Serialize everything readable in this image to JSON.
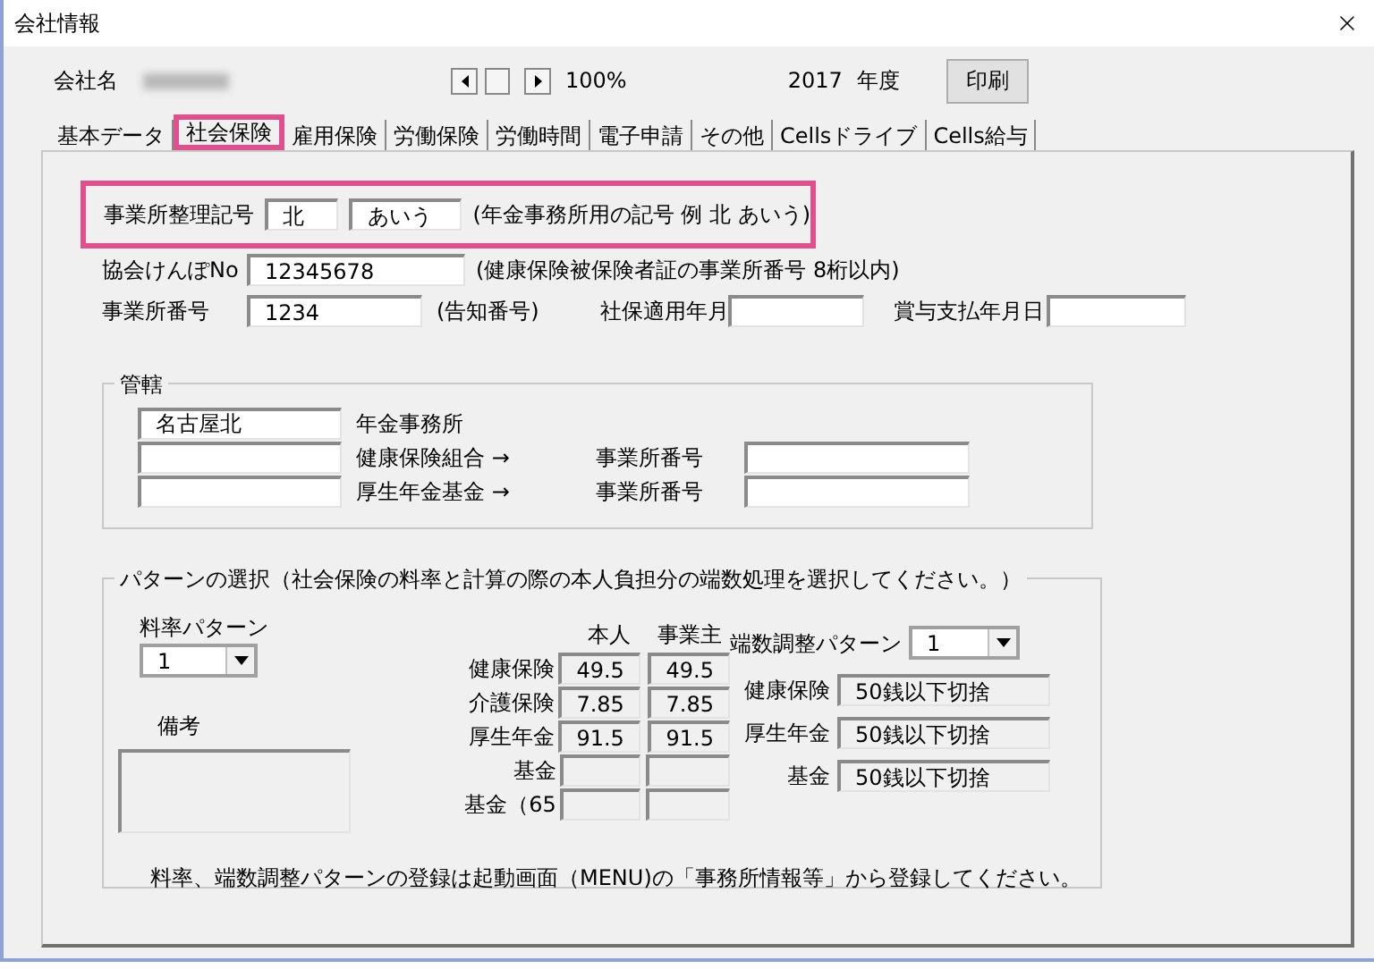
{
  "window": {
    "title": "会社情報"
  },
  "header": {
    "company_label": "会社名",
    "zoom": "100%",
    "year": "2017",
    "year_label": "年度",
    "print_button": "印刷"
  },
  "tabs": [
    {
      "label": "基本データ",
      "selected": false,
      "highlighted": false
    },
    {
      "label": "社会保険",
      "selected": true,
      "highlighted": true
    },
    {
      "label": "雇用保険",
      "selected": false,
      "highlighted": false
    },
    {
      "label": "労働保険",
      "selected": false,
      "highlighted": false
    },
    {
      "label": "労働時間",
      "selected": false,
      "highlighted": false
    },
    {
      "label": "電子申請",
      "selected": false,
      "highlighted": false
    },
    {
      "label": "その他",
      "selected": false,
      "highlighted": false
    },
    {
      "label": "Cellsドライブ",
      "selected": false,
      "highlighted": false
    },
    {
      "label": "Cells給与",
      "selected": false,
      "highlighted": false
    }
  ],
  "office_code": {
    "highlighted": true,
    "label": "事業所整理記号",
    "value_1": "北",
    "value_2": "あいう",
    "note": "(年金事務所用の記号  例  北  あいう)"
  },
  "kyokai": {
    "label": "協会けんぽNo",
    "value": "12345678",
    "note": "(健康保険被保険者証の事業所番号  8桁以内)"
  },
  "office_number": {
    "label": "事業所番号",
    "value": "1234",
    "note": "(告知番号)",
    "apply_label": "社保適用年月",
    "bonus_label": "賞与支払年月日"
  },
  "jurisdiction": {
    "title": "管轄",
    "rows": [
      {
        "value": "名古屋北",
        "label": "年金事務所"
      },
      {
        "label": "健康保険組合  →",
        "number_label": "事業所番号"
      },
      {
        "label": "厚生年金基金  →",
        "number_label": "事業所番号"
      }
    ]
  },
  "pattern": {
    "title": "パターンの選択（社会保険の料率と計算の際の本人負担分の端数処理を選択してください。）",
    "rate_pattern": {
      "label": "料率パターン",
      "value": "1"
    },
    "remarks_label": "備考",
    "columns": [
      "本人",
      "事業主"
    ],
    "rows": [
      {
        "label": "健康保険",
        "values": [
          "49.5",
          "49.5"
        ]
      },
      {
        "label": "介護保険",
        "values": [
          "7.85",
          "7.85"
        ]
      },
      {
        "label": "厚生年金",
        "values": [
          "91.5",
          "91.5"
        ]
      },
      {
        "label": "基金"
      },
      {
        "label": "基金（65"
      }
    ],
    "rounding": {
      "label": "端数調整パターン",
      "value": "1",
      "rows": [
        {
          "label": "健康保険",
          "value": "50銭以下切捨"
        },
        {
          "label": "厚生年金",
          "value": "50銭以下切捨"
        },
        {
          "label": "基金",
          "value": "50銭以下切捨"
        }
      ]
    },
    "footer": "料率、端数調整パターンの登録は起動画面（MENU)の「事務所情報等」から登録してください。"
  }
}
